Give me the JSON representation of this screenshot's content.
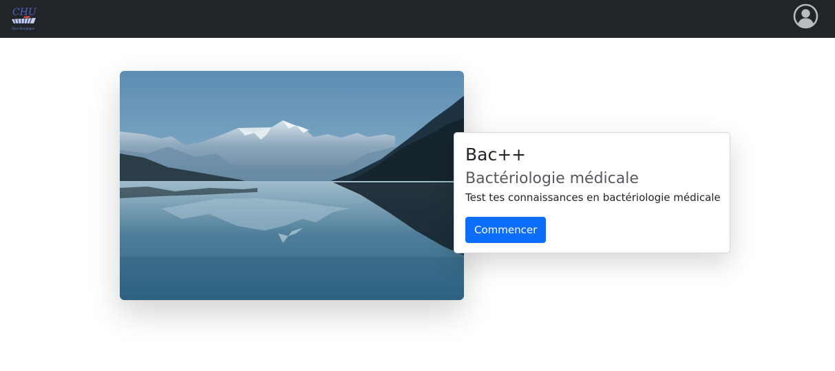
{
  "navbar": {
    "logo": {
      "text": "CHU",
      "subtext": "Dijon Bourgogne"
    },
    "avatar_icon": "user-circle-icon",
    "background_color": "#212529"
  },
  "hero": {
    "image_description_icon": "mountain-lake-image"
  },
  "card": {
    "title": "Bac++",
    "subtitle": "Bactériologie médicale",
    "text": "Test tes connaissances en bactériologie médicale",
    "button_label": "Commencer",
    "button_color": "#0d6efd"
  }
}
